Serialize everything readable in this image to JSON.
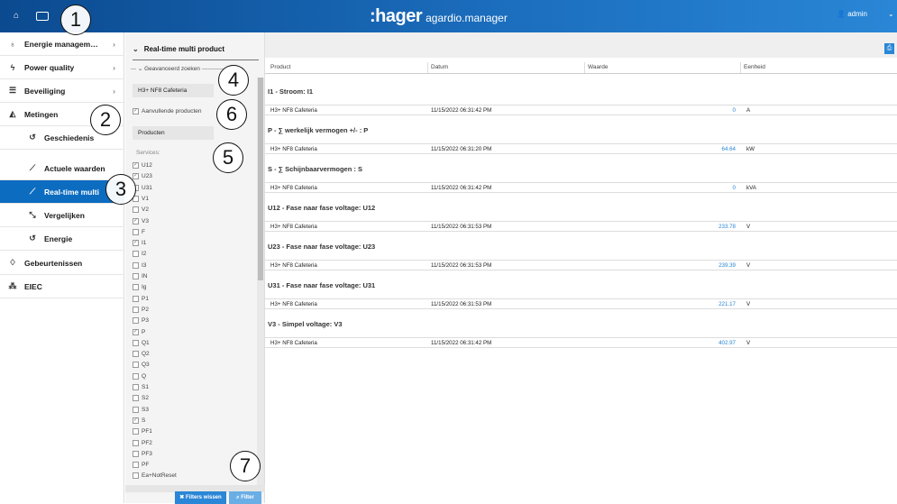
{
  "header": {
    "brand_logo": ":hager",
    "brand_app": "agardio.manager",
    "user": "admin",
    "home_icon": "home-icon",
    "monitor_icon": "monitor-icon"
  },
  "sidebar": {
    "items": [
      {
        "label": "Energie managem…",
        "icon": "bulb-icon",
        "chevron": "›"
      },
      {
        "label": "Power quality",
        "icon": "lightning-icon",
        "chevron": "›"
      },
      {
        "label": "Beveiliging",
        "icon": "sliders-icon",
        "chevron": "›"
      },
      {
        "label": "Metingen",
        "icon": "area-chart-icon"
      },
      {
        "label": "Geschiedenis",
        "icon": "history-icon"
      },
      {
        "label": "Actuele waarden",
        "icon": "line-chart-icon"
      },
      {
        "label": "Real-time multi",
        "icon": "line-chart-icon"
      },
      {
        "label": "Vergelijken",
        "icon": "compare-icon"
      },
      {
        "label": "Energie",
        "icon": "history-icon"
      },
      {
        "label": "Gebeurtenissen",
        "icon": "bell-icon"
      },
      {
        "label": "EIEC",
        "icon": "sitemap-icon"
      }
    ]
  },
  "filter": {
    "title": "Real-time multi product",
    "advanced": "Geavanceerd zoeken",
    "product_value": "H3+ NF8 Cafeteria",
    "additional_products": "Aanvullende producten",
    "products_label": "Producten",
    "services_label": "Services:",
    "services": [
      {
        "label": "U12",
        "checked": true
      },
      {
        "label": "U23",
        "checked": true
      },
      {
        "label": "U31",
        "checked": false
      },
      {
        "label": "V1",
        "checked": false
      },
      {
        "label": "V2",
        "checked": false
      },
      {
        "label": "V3",
        "checked": true
      },
      {
        "label": "F",
        "checked": false
      },
      {
        "label": "I1",
        "checked": true
      },
      {
        "label": "I2",
        "checked": false
      },
      {
        "label": "I3",
        "checked": false
      },
      {
        "label": "IN",
        "checked": false
      },
      {
        "label": "Ig",
        "checked": false
      },
      {
        "label": "P1",
        "checked": false
      },
      {
        "label": "P2",
        "checked": false
      },
      {
        "label": "P3",
        "checked": false
      },
      {
        "label": "P",
        "checked": true
      },
      {
        "label": "Q1",
        "checked": false
      },
      {
        "label": "Q2",
        "checked": false
      },
      {
        "label": "Q3",
        "checked": false
      },
      {
        "label": "Q",
        "checked": false
      },
      {
        "label": "S1",
        "checked": false
      },
      {
        "label": "S2",
        "checked": false
      },
      {
        "label": "S3",
        "checked": false
      },
      {
        "label": "S",
        "checked": true
      },
      {
        "label": "PF1",
        "checked": false
      },
      {
        "label": "PF2",
        "checked": false
      },
      {
        "label": "PF3",
        "checked": false
      },
      {
        "label": "PF",
        "checked": false
      },
      {
        "label": "Ea+NotReset",
        "checked": false
      }
    ],
    "clear_button": "Filters wissen",
    "filter_button": "Filter"
  },
  "table": {
    "headers": [
      "Product",
      "Datum",
      "Waarde",
      "Eenheid"
    ],
    "groups": [
      {
        "title": "I1 - Stroom: I1",
        "row": {
          "product": "H3+ NF8 Cafeteria",
          "date": "11/15/2022 06:31:42 PM",
          "value": "0",
          "unit": "A"
        }
      },
      {
        "title": "P - ∑ werkelijk vermogen +/- : P",
        "row": {
          "product": "H3+ NF8 Cafeteria",
          "date": "11/15/2022 06:31:20 PM",
          "value": "64.64",
          "unit": "kW"
        }
      },
      {
        "title": "S - ∑ Schijnbaarvermogen : S",
        "row": {
          "product": "H3+ NF8 Cafeteria",
          "date": "11/15/2022 06:31:42 PM",
          "value": "0",
          "unit": "kVA"
        }
      },
      {
        "title": "U12 - Fase naar fase voltage: U12",
        "row": {
          "product": "H3+ NF8 Cafeteria",
          "date": "11/15/2022 06:31:53 PM",
          "value": "233.78",
          "unit": "V"
        }
      },
      {
        "title": "U23 - Fase naar fase voltage: U23",
        "row": {
          "product": "H3+ NF8 Cafeteria",
          "date": "11/15/2022 06:31:53 PM",
          "value": "239.39",
          "unit": "V"
        }
      },
      {
        "title": "U31 - Fase naar fase voltage: U31",
        "row": {
          "product": "H3+ NF8 Cafeteria",
          "date": "11/15/2022 06:31:53 PM",
          "value": "221.17",
          "unit": "V"
        }
      },
      {
        "title": "V3 - Simpel voltage: V3",
        "row": {
          "product": "H3+ NF8 Cafeteria",
          "date": "11/15/2022 06:31:42 PM",
          "value": "402.97",
          "unit": "V"
        }
      }
    ]
  },
  "annotations": [
    "1",
    "2",
    "3",
    "4",
    "5",
    "6",
    "7"
  ]
}
